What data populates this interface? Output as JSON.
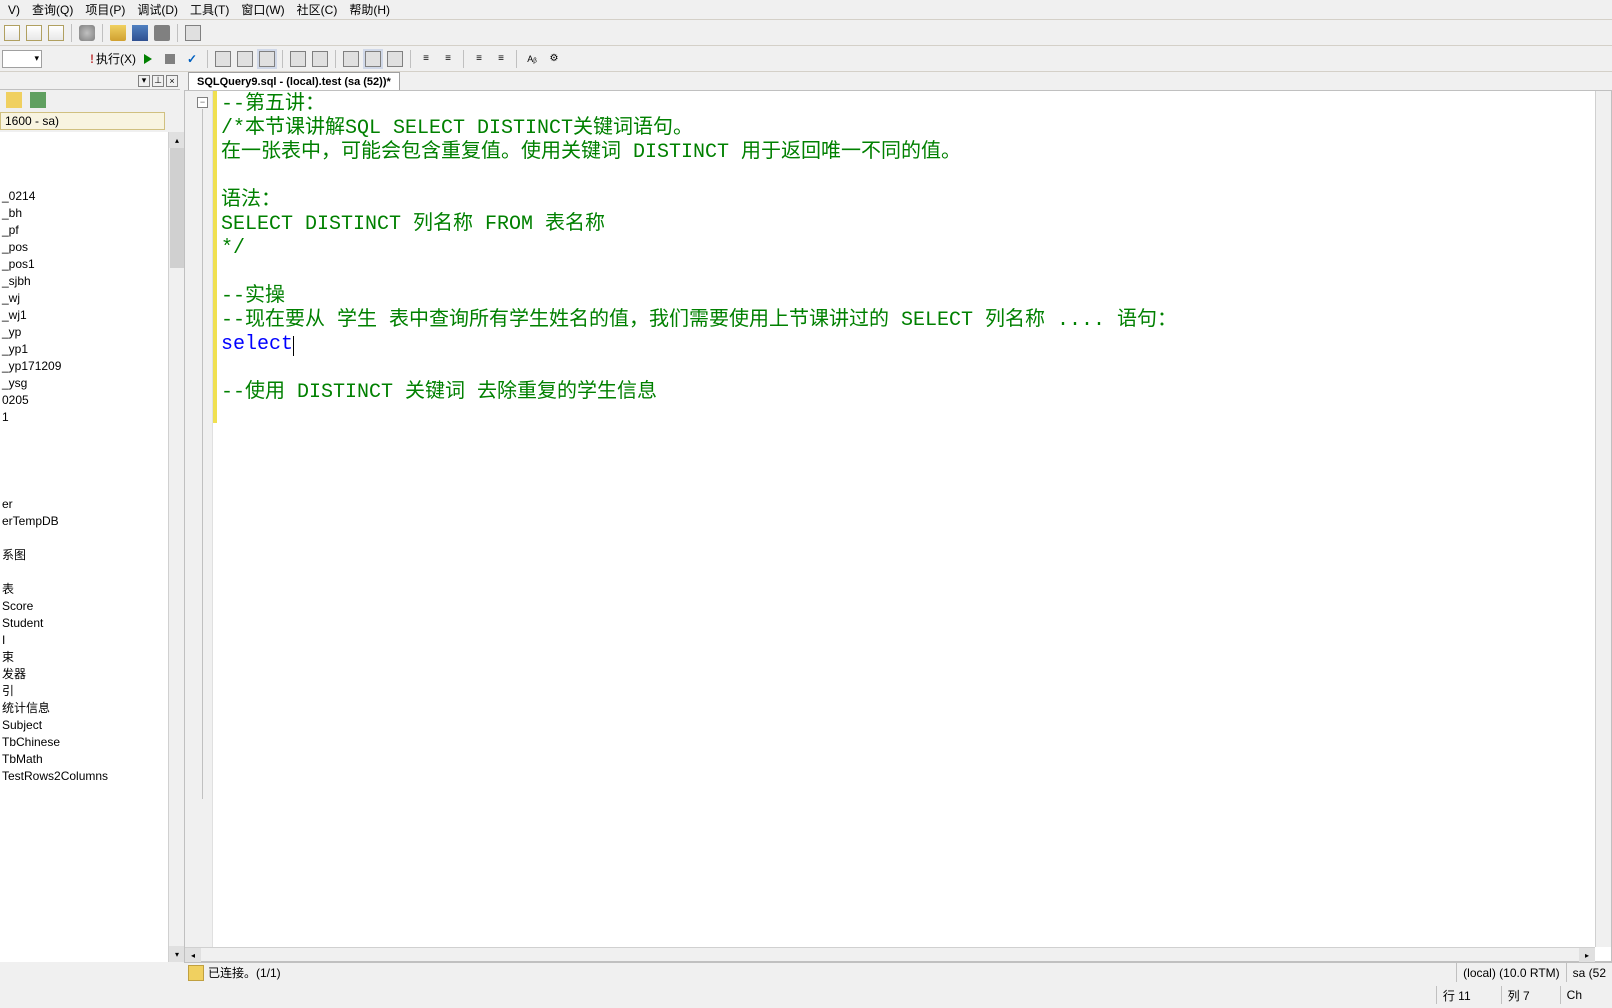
{
  "menu": {
    "items": [
      "V)",
      "查询(Q)",
      "项目(P)",
      "调试(D)",
      "工具(T)",
      "窗口(W)",
      "社区(C)",
      "帮助(H)"
    ]
  },
  "toolbar2": {
    "execute_label": "执行(X)"
  },
  "sidebar": {
    "connection": "1600 - sa)",
    "items": [
      "_0214",
      "_bh",
      "_pf",
      "_pos",
      "_pos1",
      "_sjbh",
      "_wj",
      "_wj1",
      "_yp",
      "_yp1",
      "_yp171209",
      "_ysg",
      "0205",
      "1"
    ],
    "gap_items": [
      "er",
      "erTempDB"
    ],
    "gap2_items": [
      "系图"
    ],
    "gap3_items": [
      "表",
      "Score",
      "Student",
      "I",
      "束",
      "发器",
      "引",
      "统计信息",
      "Subject",
      "TbChinese",
      "TbMath",
      "TestRows2Columns"
    ]
  },
  "tab": {
    "title": "SQLQuery9.sql - (local).test (sa (52))*"
  },
  "code": {
    "line1": "--第五讲：",
    "line2": "/*本节课讲解SQL SELECT DISTINCT关键词语句。",
    "line3": "在一张表中，可能会包含重复值。使用关键词 DISTINCT 用于返回唯一不同的值。",
    "line4": "",
    "line5": "语法：",
    "line6": "SELECT DISTINCT 列名称 FROM 表名称",
    "line7": "*/",
    "line8": "",
    "line9": "--实操",
    "line10": "--现在要从 学生 表中查询所有学生姓名的值，我们需要使用上节课讲过的 SELECT 列名称 .... 语句：",
    "line11": "select",
    "line12": "",
    "line13": "--使用 DISTINCT 关键词 去除重复的学生信息"
  },
  "status": {
    "connected": "已连接。(1/1)",
    "server": "(local) (10.0 RTM)",
    "user": "sa (52",
    "row": "行 11",
    "col": "列 7",
    "ch": "Ch"
  }
}
